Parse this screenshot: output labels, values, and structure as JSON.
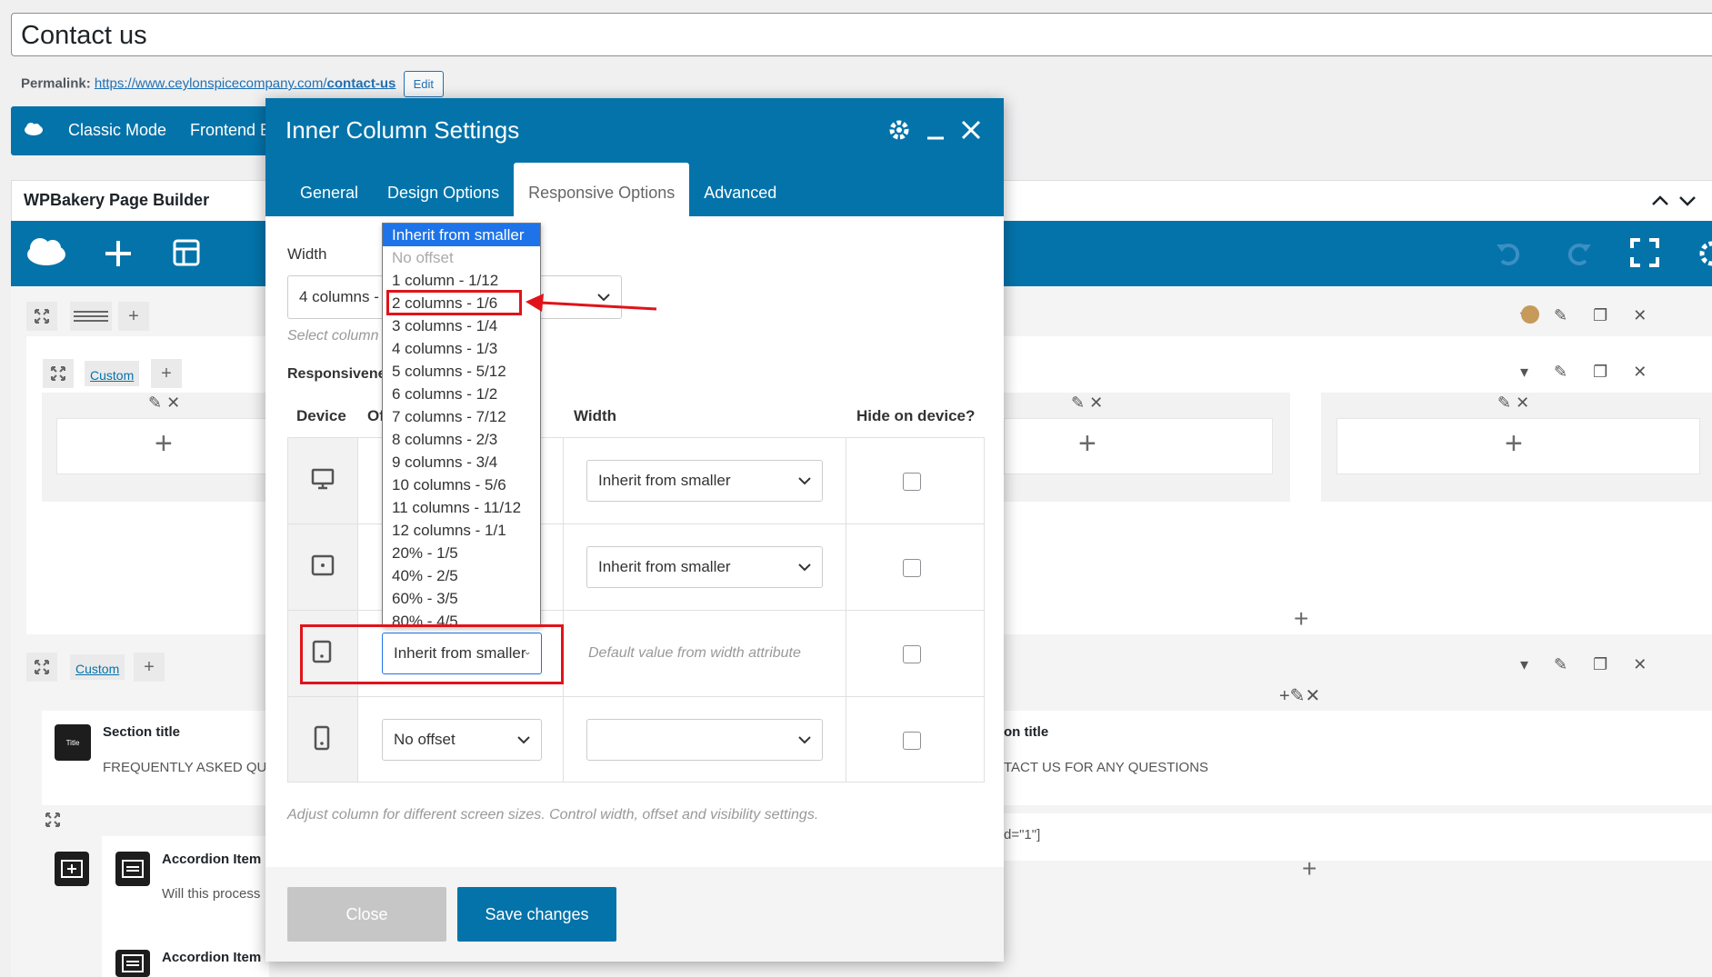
{
  "editor": {
    "page_title": "Contact us",
    "permalink_label": "Permalink:",
    "permalink_url_base": "https://www.ceylonspicecompany.com/",
    "permalink_slug": "contact-us",
    "edit_label": "Edit"
  },
  "mode_bar": {
    "classic_mode": "Classic Mode",
    "frontend": "Frontend E"
  },
  "builder": {
    "title": "WPBakery Page Builder",
    "custom_label": "Custom",
    "section_title_1": "Section title",
    "section_text_1": "FREQUENTLY ASKED QUE",
    "section_title_2": "on title",
    "section_text_2": "TACT US FOR ANY QUESTIONS",
    "shortcode_frag": "d=\"1\"]",
    "accordion_1_title": "Accordion Item",
    "accordion_1_text": "Will this process",
    "accordion_2_title": "Accordion Item",
    "title_icon_text": "Title"
  },
  "modal": {
    "title": "Inner Column Settings",
    "tabs": [
      "General",
      "Design Options",
      "Responsive Options",
      "Advanced"
    ],
    "active_tab": "Responsive Options",
    "width_label": "Width",
    "width_value": "4 columns - ",
    "select_hint": "Select column",
    "responsive_label": "Responsivene",
    "columns": {
      "device": "Device",
      "offset": "Of",
      "width": "Width",
      "hide": "Hide on device?"
    },
    "rows": [
      {
        "device": "desktop",
        "offset": "",
        "width": "Inherit from smaller",
        "hidden": false
      },
      {
        "device": "tablet-landscape",
        "offset": "",
        "width": "Inherit from smaller",
        "hidden": false
      },
      {
        "device": "tablet-portrait",
        "offset": "Inherit from smaller",
        "width_hint": "Default value from width attribute",
        "hidden": false
      },
      {
        "device": "mobile",
        "offset": "No offset",
        "width": "",
        "hidden": false
      }
    ],
    "footer_hint": "Adjust column for different screen sizes. Control width, offset and visibility settings.",
    "close_label": "Close",
    "save_label": "Save changes"
  },
  "dropdown": {
    "selected": "Inherit from smaller",
    "options": [
      "Inherit from smaller",
      "No offset",
      "1 column - 1/12",
      "2 columns - 1/6",
      "3 columns - 1/4",
      "4 columns - 1/3",
      "5 columns - 5/12",
      "6 columns - 1/2",
      "7 columns - 7/12",
      "8 columns - 2/3",
      "9 columns - 3/4",
      "10 columns - 5/6",
      "11 columns - 11/12",
      "12 columns - 1/1",
      "20% - 1/5",
      "40% - 2/5",
      "60% - 3/5",
      "80% - 4/5"
    ],
    "highlighted": "2 columns - 1/6"
  },
  "colors": {
    "primary": "#0473aa",
    "annotation": "#e0131a",
    "selection": "#1e73e8"
  }
}
